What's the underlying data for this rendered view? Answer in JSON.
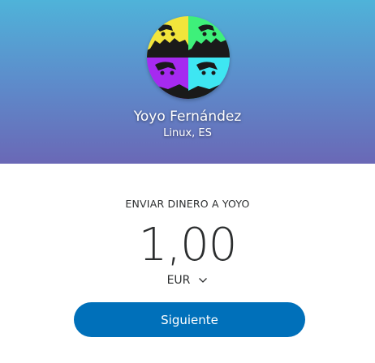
{
  "recipient": {
    "name": "Yoyo Fernández",
    "location": "Linux, ES",
    "avatar_colors": [
      "#f2e53b",
      "#3ef07a",
      "#a62af0",
      "#3ee6f2"
    ]
  },
  "form": {
    "send_label": "ENVIAR DINERO A YOYO",
    "amount": "1,00",
    "currency": "EUR",
    "currency_icon": "chevron-down-icon",
    "next_button_label": "Siguiente"
  },
  "colors": {
    "header_top": "#4fb3d9",
    "header_bottom": "#6a68b6",
    "button": "#0070ba",
    "text": "#2c2e2f"
  }
}
